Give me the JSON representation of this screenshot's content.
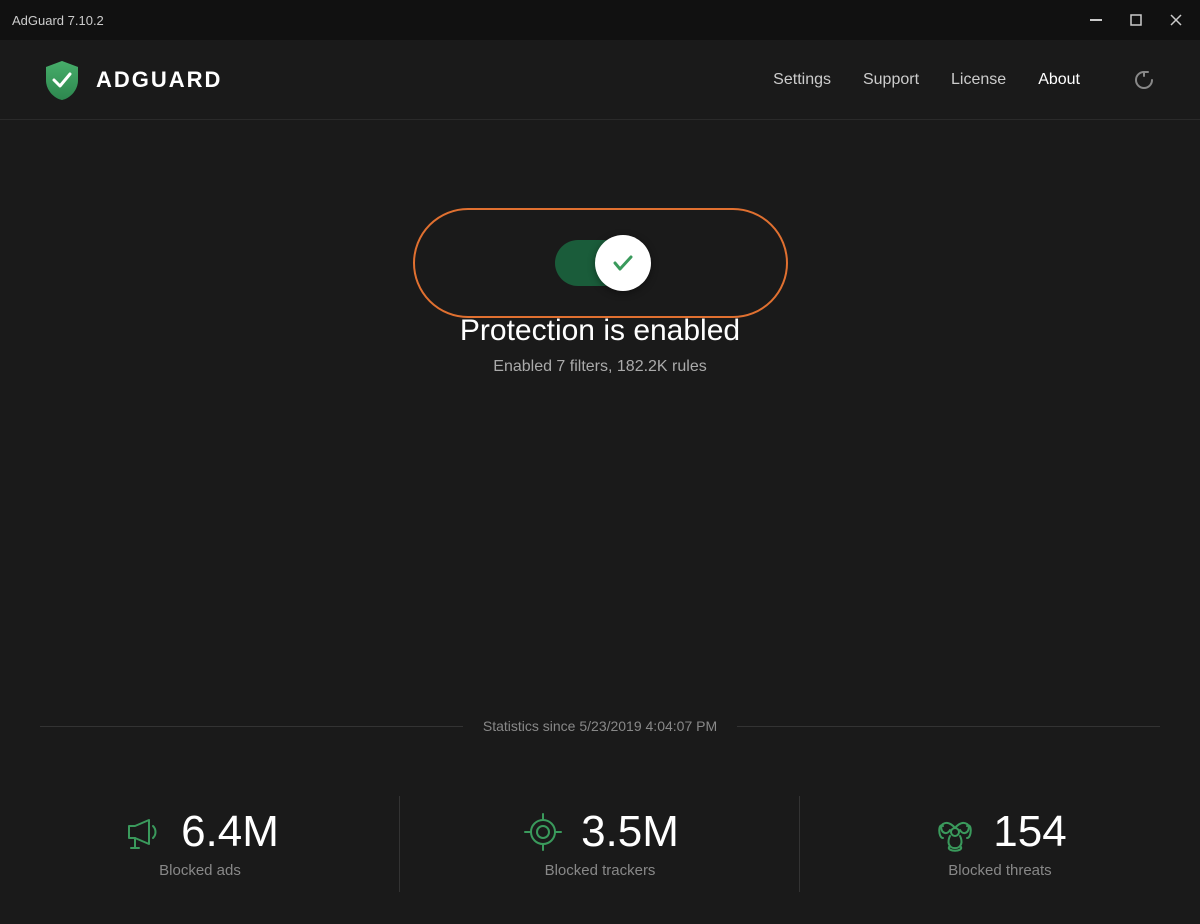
{
  "titlebar": {
    "title": "AdGuard 7.10.2"
  },
  "header": {
    "logo_text": "ADGUARD",
    "nav": {
      "settings": "Settings",
      "support": "Support",
      "license": "License",
      "about": "About"
    }
  },
  "protection": {
    "toggle_state": "enabled",
    "status_title": "Protection is enabled",
    "status_subtitle": "Enabled 7 filters, 182.2K rules"
  },
  "stats": {
    "since_label": "Statistics since 5/23/2019 4:04:07 PM",
    "items": [
      {
        "value": "6.4M",
        "label": "Blocked ads"
      },
      {
        "value": "3.5M",
        "label": "Blocked trackers"
      },
      {
        "value": "154",
        "label": "Blocked threats"
      }
    ]
  }
}
